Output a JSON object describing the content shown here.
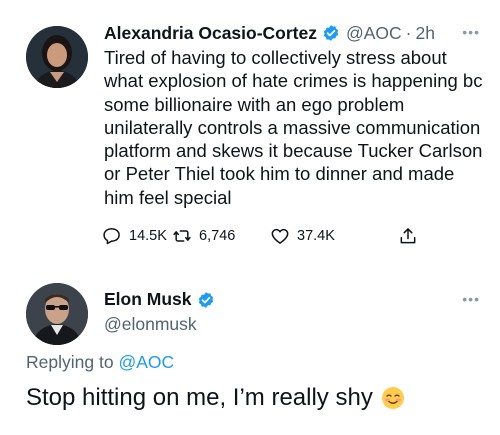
{
  "original_tweet": {
    "author_name": "Alexandria Ocasio-Cortez",
    "handle": "@AOC",
    "separator": "·",
    "time": "2h",
    "text": "Tired of having to collectively stress about what explosion of hate crimes is happening bc some billionaire with an ego problem unilaterally controls a massive communication platform and skews it because Tucker Carlson or Peter Thiel took him to dinner and made him feel special",
    "replies": "14.5K",
    "retweets": "6,746",
    "likes": "37.4K",
    "verified_icon": "verified-badge-icon",
    "more_icon": "more-options-icon"
  },
  "reply_tweet": {
    "author_name": "Elon Musk",
    "handle": "@elonmusk",
    "replying_label": "Replying to",
    "replying_to": "@AOC",
    "text": "Stop hitting on me, I’m really shy",
    "emoji_icon": "smiling-blushing-face-icon",
    "verified_icon": "verified-badge-icon",
    "more_icon": "more-options-icon"
  },
  "colors": {
    "text": "#0f1419",
    "secondary": "#536471",
    "link": "#1d9bf0",
    "verified": "#1d9bf0"
  }
}
